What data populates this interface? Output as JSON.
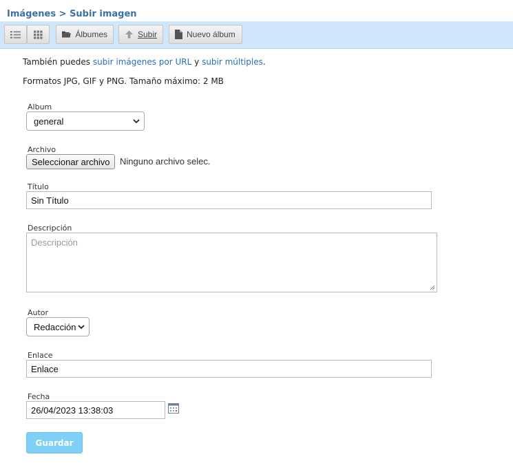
{
  "breadcrumb": {
    "parent": "Imágenes",
    "separator": ">",
    "current": "Subir imagen"
  },
  "toolbar": {
    "albums_label": "Álbumes",
    "upload_label": "Subir",
    "new_album_label": "Nuevo álbum"
  },
  "info": {
    "line1_prefix": "También puedes ",
    "url_link": "subir imágenes por URL",
    "and": " y ",
    "multiple_link": "subir múltiples",
    "dot": ".",
    "formats": "Formatos JPG, GIF y PNG. Tamaño máximo: 2 MB"
  },
  "form": {
    "album_label": "Album",
    "album_value": "general",
    "file_label": "Archivo",
    "file_button": "Seleccionar archivo",
    "file_status": "Ninguno archivo selec.",
    "title_label": "Título",
    "title_value": "Sin Título",
    "description_label": "Descripción",
    "description_placeholder": "Descripción",
    "author_label": "Autor",
    "author_value": "Redacción",
    "link_label": "Enlace",
    "link_value": "Enlace",
    "date_label": "Fecha",
    "date_value": "26/04/2023 13:38:03",
    "save_button": "Guardar"
  }
}
